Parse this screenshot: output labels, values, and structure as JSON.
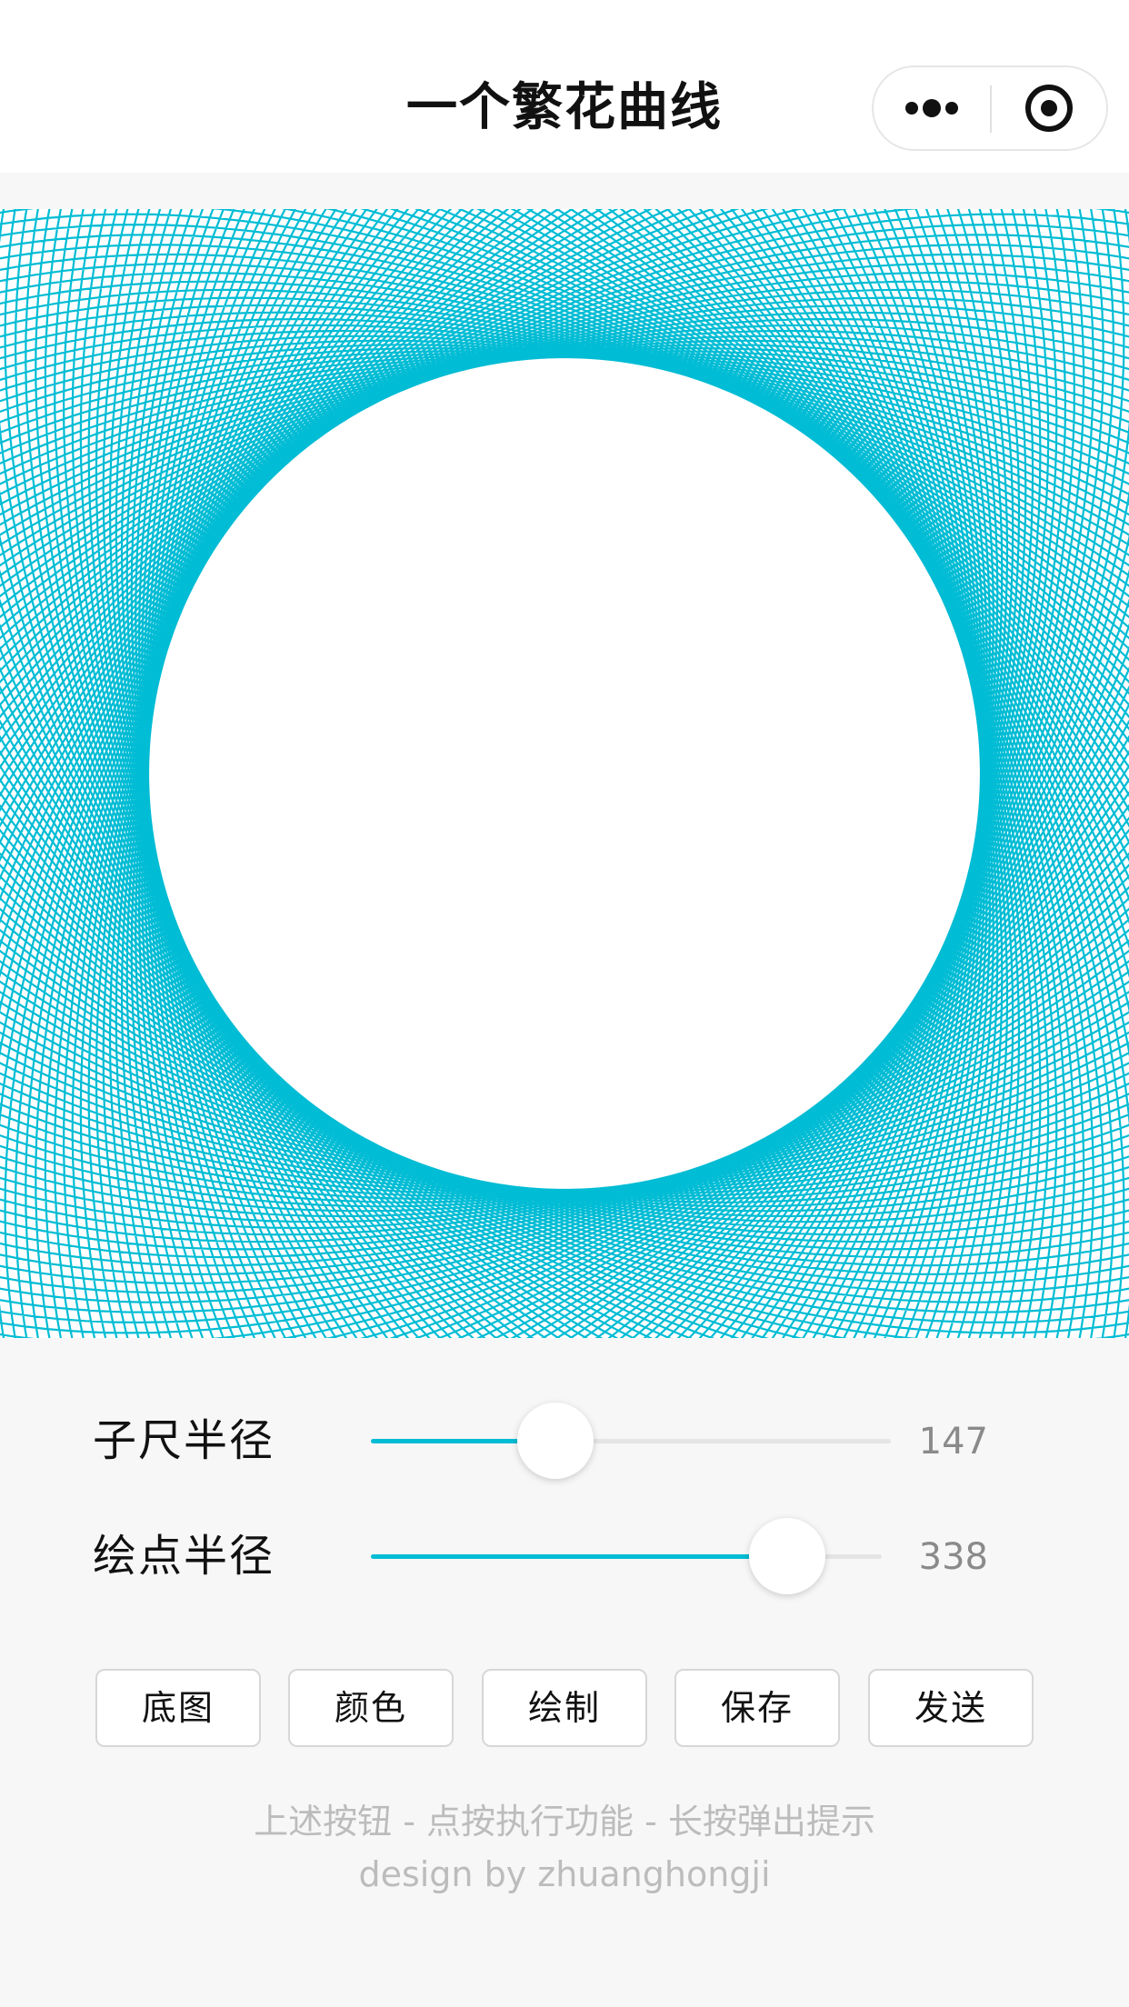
{
  "navbar": {
    "title": "一个繁花曲线",
    "more_icon": "more-dots-icon",
    "close_icon": "target-circle-icon"
  },
  "canvas": {
    "stroke_color": "#00bcd4",
    "background": "#ffffff"
  },
  "sliders": [
    {
      "label": "子尺半径",
      "value": "147",
      "fraction": 0.355
    },
    {
      "label": "绘点半径",
      "value": "338",
      "fraction": 0.815
    }
  ],
  "buttons": [
    {
      "label": "底图"
    },
    {
      "label": "颜色"
    },
    {
      "label": "绘制"
    },
    {
      "label": "保存"
    },
    {
      "label": "发送"
    }
  ],
  "footer": {
    "hint": "上述按钮 - 点按执行功能 - 长按弹出提示",
    "credit": "design by zhuanghongji"
  },
  "colors": {
    "accent": "#00bcd4",
    "page_bg": "#f7f7f7",
    "footer_text": "#bcbcbc"
  }
}
